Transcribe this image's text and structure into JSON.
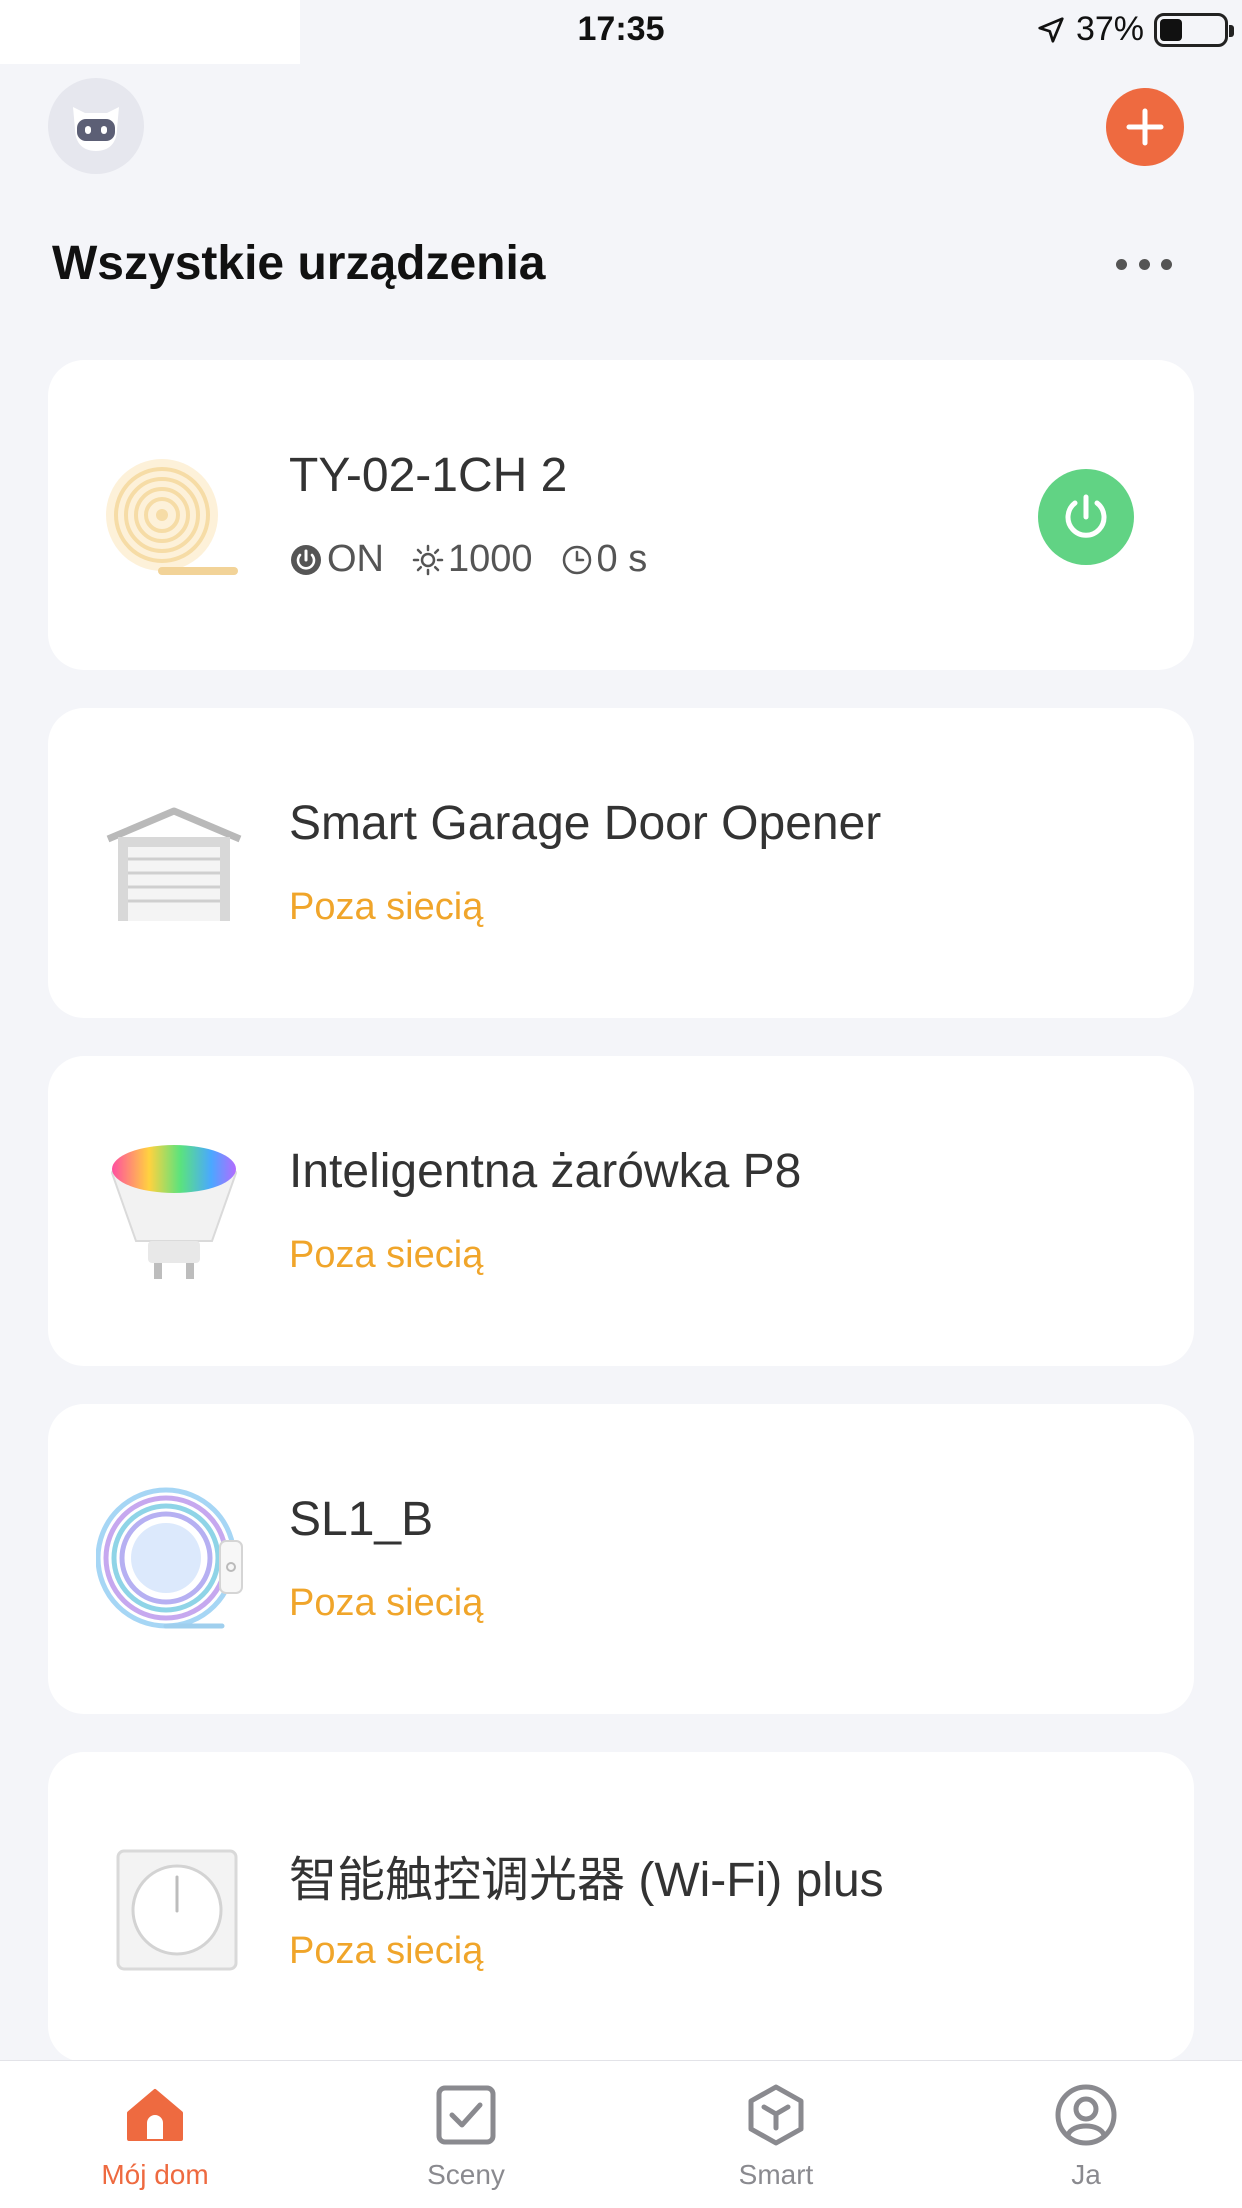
{
  "status_bar": {
    "time": "17:35",
    "battery": "37%"
  },
  "header": {
    "title": "Wszystkie urządzenia"
  },
  "devices": [
    {
      "name": "TY-02-1CH 2",
      "power": "ON",
      "brightness": "1000",
      "timer": "0 s",
      "power_button_color": "#61d384"
    },
    {
      "name": "Smart Garage Door Opener",
      "status": "Poza siecią"
    },
    {
      "name": "Inteligentna żarówka P8",
      "status": "Poza siecią"
    },
    {
      "name": "SL1_B",
      "status": "Poza siecią"
    },
    {
      "name": "智能触控调光器 (Wi-Fi) plus",
      "status": "Poza siecią"
    }
  ],
  "tabs": [
    {
      "label": "Mój dom",
      "icon": "home-icon",
      "active": true
    },
    {
      "label": "Sceny",
      "icon": "checkbox-icon",
      "active": false
    },
    {
      "label": "Smart",
      "icon": "cube-icon",
      "active": false
    },
    {
      "label": "Ja",
      "icon": "user-icon",
      "active": false
    }
  ],
  "colors": {
    "accent": "#ee6a40",
    "offline": "#f0a52a",
    "background": "#f4f5f9"
  }
}
